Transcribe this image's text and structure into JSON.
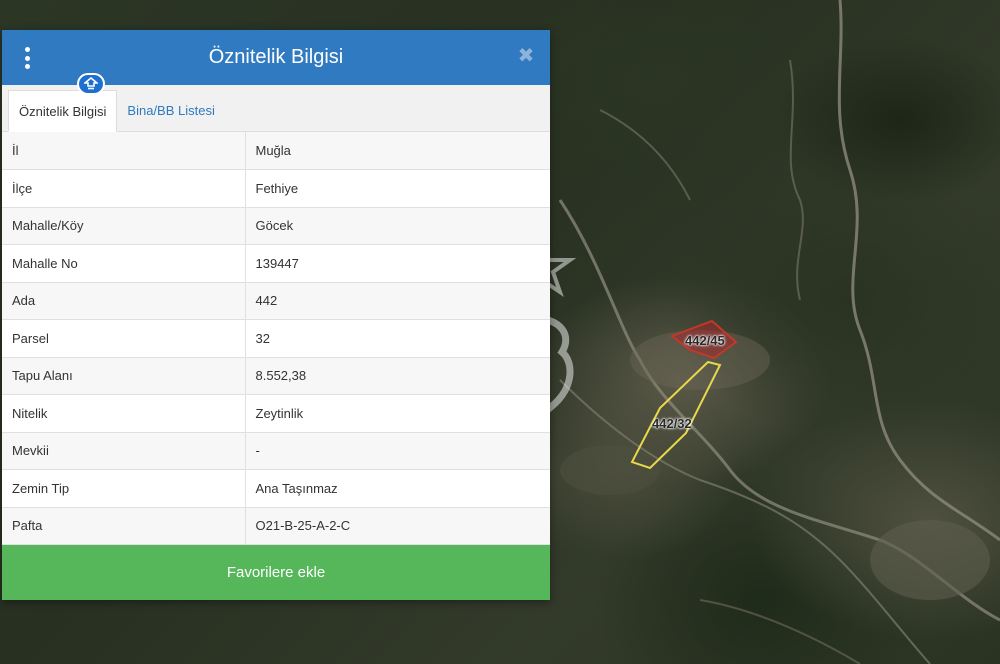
{
  "dialog": {
    "title": "Öznitelik Bilgisi",
    "menu_icon": "vertical-dots-icon",
    "close_icon": "close-icon",
    "pin_icon": "pin-icon",
    "tabs": [
      {
        "label": "Öznitelik Bilgisi",
        "active": true
      },
      {
        "label": "Bina/BB Listesi",
        "active": false
      }
    ],
    "rows": [
      {
        "key": "İl",
        "value": "Muğla"
      },
      {
        "key": "İlçe",
        "value": "Fethiye"
      },
      {
        "key": "Mahalle/Köy",
        "value": "Göcek"
      },
      {
        "key": "Mahalle No",
        "value": "139447"
      },
      {
        "key": "Ada",
        "value": "442"
      },
      {
        "key": "Parsel",
        "value": "32"
      },
      {
        "key": "Tapu Alanı",
        "value": "8.552,38"
      },
      {
        "key": "Nitelik",
        "value": "Zeytinlik"
      },
      {
        "key": "Mevkii",
        "value": "-"
      },
      {
        "key": "Zemin Tip",
        "value": "Ana Taşınmaz"
      },
      {
        "key": "Pafta",
        "value": "O21-B-25-A-2-C"
      }
    ],
    "favorite_button": "Favorilere ekle"
  },
  "map": {
    "parcels": [
      {
        "label": "442/45",
        "color": "#c0392b"
      },
      {
        "label": "442/32",
        "color": "#e8d84a"
      }
    ],
    "watermark_icon": "cb-logo-watermark"
  },
  "colors": {
    "header": "#2f7ac1",
    "favorite": "#55b65a"
  }
}
